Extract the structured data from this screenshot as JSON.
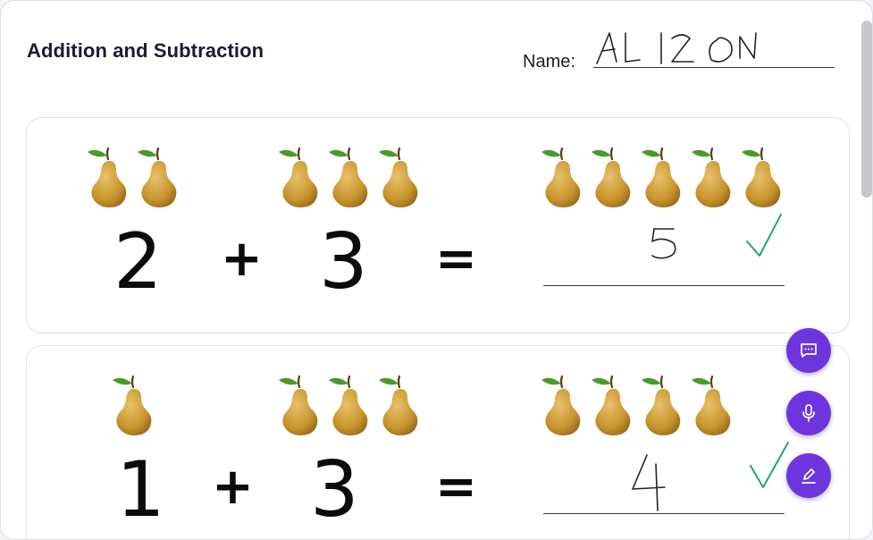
{
  "header": {
    "title": "Addition and Subtraction",
    "name_label": "Name:",
    "student_name_handwritten": "ALIZON"
  },
  "problems": [
    {
      "a": "2",
      "operator": "+",
      "b": "3",
      "equals": "=",
      "answer_handwritten": "5",
      "correct": true,
      "pears_a": 2,
      "pears_b": 3,
      "pears_result": 5
    },
    {
      "a": "1",
      "operator": "+",
      "b": "3",
      "equals": "=",
      "answer_handwritten": "4",
      "correct": true,
      "pears_a": 1,
      "pears_b": 3,
      "pears_result": 4
    }
  ],
  "fabs": [
    {
      "name": "comment-button",
      "icon": "comment-icon"
    },
    {
      "name": "microphone-button",
      "icon": "microphone-icon"
    },
    {
      "name": "pen-button",
      "icon": "pen-icon"
    }
  ],
  "colors": {
    "accent": "#6d35de",
    "check": "#1fa67a",
    "pear": "#c9962e",
    "leaf": "#4a9a2a"
  }
}
